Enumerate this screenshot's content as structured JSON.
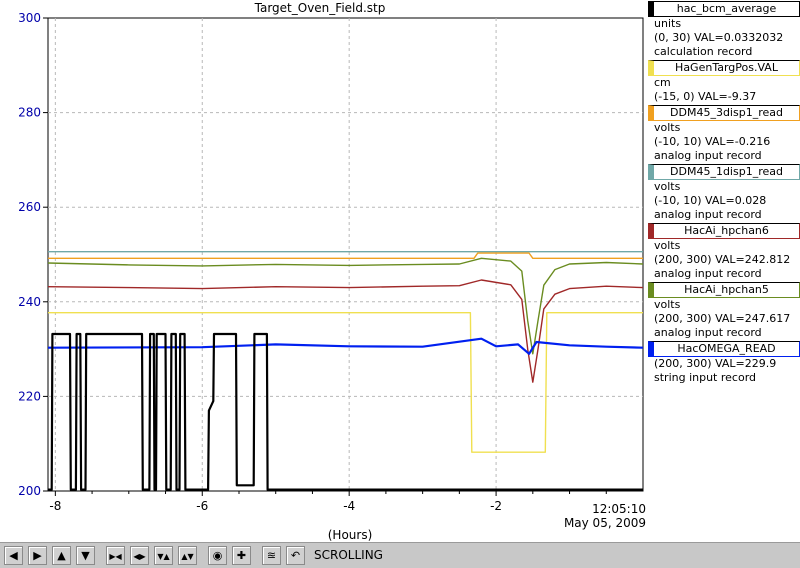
{
  "window_title": "Target_Oven_Field.stp",
  "x_axis_unit": "(Hours)",
  "timestamp": {
    "time": "12:05:10",
    "date": "May 05, 2009"
  },
  "legend": [
    {
      "name": "hac_bcm_average",
      "color": "#000000",
      "lines": [
        "units",
        "(0, 30) VAL=0.0332032",
        "calculation record"
      ]
    },
    {
      "name": "HaGenTargPos.VAL",
      "color": "#f0e050",
      "lines": [
        "cm",
        "(-15, 0) VAL=-9.37"
      ]
    },
    {
      "name": "DDM45_3disp1_read",
      "color": "#f0a020",
      "lines": [
        "volts",
        "(-10, 10) VAL=-0.216",
        "analog input record"
      ]
    },
    {
      "name": "DDM45_1disp1_read",
      "color": "#70a8a8",
      "lines": [
        "volts",
        "(-10, 10) VAL=0.028",
        "analog input record"
      ]
    },
    {
      "name": "HacAi_hpchan6",
      "color": "#a02828",
      "lines": [
        "volts",
        "(200, 300) VAL=242.812",
        "analog input record"
      ]
    },
    {
      "name": "HacAi_hpchan5",
      "color": "#6a8c20",
      "lines": [
        "volts",
        "(200, 300) VAL=247.617",
        "analog input record"
      ]
    },
    {
      "name": "HacOMEGA_READ",
      "color": "#0020f0",
      "lines": [
        "(200, 300) VAL=229.9",
        "string input record"
      ]
    }
  ],
  "toolbar": {
    "buttons": [
      {
        "name": "scroll-left-button",
        "icon": "arrow-left-icon",
        "glyph": "◀"
      },
      {
        "name": "scroll-right-button",
        "icon": "arrow-right-icon",
        "glyph": "▶"
      },
      {
        "name": "scroll-up-button",
        "icon": "arrow-up-icon",
        "glyph": "▲"
      },
      {
        "name": "scroll-down-button",
        "icon": "arrow-down-icon",
        "glyph": "▼"
      },
      {
        "name": "zoom-in-horizontal-button",
        "icon": "zoom-in-horizontal-icon",
        "glyph": "▶◀"
      },
      {
        "name": "zoom-out-horizontal-button",
        "icon": "zoom-out-horizontal-icon",
        "glyph": "◀▶"
      },
      {
        "name": "zoom-in-vertical-button",
        "icon": "zoom-in-vertical-icon",
        "glyph": "▼▲"
      },
      {
        "name": "zoom-out-vertical-button",
        "icon": "zoom-out-vertical-icon",
        "glyph": "▲▼"
      },
      {
        "name": "autozoom-button",
        "icon": "target-icon",
        "glyph": "◉"
      },
      {
        "name": "add-cursor-button",
        "icon": "plus-icon",
        "glyph": "✚"
      },
      {
        "name": "stagger-button",
        "icon": "stagger-icon",
        "glyph": "≊"
      },
      {
        "name": "undo-button",
        "icon": "undo-icon",
        "glyph": "↶"
      }
    ],
    "status": "SCROLLING"
  },
  "chart_data": {
    "type": "line",
    "title": "Target_Oven_Field.stp",
    "xlabel": "(Hours)",
    "ylabel": "",
    "xlim": [
      -8.1,
      0
    ],
    "ylim": [
      200,
      300
    ],
    "x_ticks": [
      -8,
      -6,
      -4,
      -2
    ],
    "y_ticks": [
      200,
      220,
      240,
      260,
      280,
      300
    ],
    "grid": true,
    "legend_position": "right",
    "series": [
      {
        "name": "DDM45_1disp1_read",
        "color": "#70a8a8",
        "points": [
          [
            -8.1,
            250.6
          ],
          [
            0,
            250.6
          ]
        ]
      },
      {
        "name": "DDM45_3disp1_read",
        "color": "#f0a020",
        "points": [
          [
            -8.1,
            249.2
          ],
          [
            -2.3,
            249.2
          ],
          [
            -2.25,
            250.3
          ],
          [
            -1.55,
            250.3
          ],
          [
            -1.5,
            249.2
          ],
          [
            0,
            249.2
          ]
        ]
      },
      {
        "name": "HacAi_hpchan5",
        "color": "#6a8c20",
        "points": [
          [
            -8.1,
            248.2
          ],
          [
            -7.0,
            247.8
          ],
          [
            -6.0,
            247.6
          ],
          [
            -5.0,
            247.9
          ],
          [
            -4.0,
            247.7
          ],
          [
            -3.0,
            247.9
          ],
          [
            -2.5,
            248.0
          ],
          [
            -2.2,
            249.2
          ],
          [
            -1.8,
            248.6
          ],
          [
            -1.65,
            246.5
          ],
          [
            -1.57,
            236.0
          ],
          [
            -1.5,
            229.0
          ],
          [
            -1.43,
            236.0
          ],
          [
            -1.35,
            243.5
          ],
          [
            -1.2,
            246.8
          ],
          [
            -1.0,
            248.0
          ],
          [
            -0.5,
            248.3
          ],
          [
            0,
            248.0
          ]
        ]
      },
      {
        "name": "HacAi_hpchan6",
        "color": "#a02828",
        "points": [
          [
            -8.1,
            243.2
          ],
          [
            -7.0,
            243.0
          ],
          [
            -6.0,
            242.8
          ],
          [
            -5.0,
            243.2
          ],
          [
            -4.0,
            243.0
          ],
          [
            -3.0,
            243.3
          ],
          [
            -2.5,
            243.4
          ],
          [
            -2.2,
            244.6
          ],
          [
            -1.8,
            243.6
          ],
          [
            -1.65,
            240.5
          ],
          [
            -1.57,
            230.0
          ],
          [
            -1.5,
            223.0
          ],
          [
            -1.43,
            230.0
          ],
          [
            -1.35,
            238.5
          ],
          [
            -1.2,
            241.6
          ],
          [
            -1.0,
            242.8
          ],
          [
            -0.5,
            243.3
          ],
          [
            0,
            243.0
          ]
        ]
      },
      {
        "name": "HaGenTargPos.VAL",
        "color": "#f0e050",
        "points": [
          [
            -8.1,
            237.7
          ],
          [
            -2.35,
            237.7
          ],
          [
            -2.33,
            208.2
          ],
          [
            -1.33,
            208.2
          ],
          [
            -1.31,
            237.7
          ],
          [
            0,
            237.7
          ]
        ]
      },
      {
        "name": "HacOMEGA_READ",
        "color": "#0020f0",
        "points": [
          [
            -8.1,
            230.3
          ],
          [
            -6.0,
            230.4
          ],
          [
            -5.0,
            231.0
          ],
          [
            -4.0,
            230.6
          ],
          [
            -3.0,
            230.5
          ],
          [
            -2.2,
            232.2
          ],
          [
            -2.0,
            230.6
          ],
          [
            -1.7,
            231.0
          ],
          [
            -1.55,
            229.0
          ],
          [
            -1.45,
            231.5
          ],
          [
            -1.0,
            230.8
          ],
          [
            -0.5,
            230.5
          ],
          [
            0,
            230.3
          ]
        ]
      },
      {
        "name": "hac_bcm_average",
        "color": "#000000",
        "points": [
          [
            -8.1,
            200.3
          ],
          [
            -8.05,
            200.3
          ],
          [
            -8.04,
            233.2
          ],
          [
            -7.8,
            233.2
          ],
          [
            -7.79,
            200.3
          ],
          [
            -7.72,
            200.3
          ],
          [
            -7.71,
            233.2
          ],
          [
            -7.66,
            233.2
          ],
          [
            -7.65,
            200.3
          ],
          [
            -7.59,
            200.3
          ],
          [
            -7.58,
            233.2
          ],
          [
            -6.82,
            233.2
          ],
          [
            -6.81,
            200.3
          ],
          [
            -6.72,
            200.3
          ],
          [
            -6.71,
            233.2
          ],
          [
            -6.66,
            233.2
          ],
          [
            -6.65,
            200.3
          ],
          [
            -6.63,
            200.3
          ],
          [
            -6.62,
            233.2
          ],
          [
            -6.5,
            233.2
          ],
          [
            -6.49,
            200.3
          ],
          [
            -6.43,
            200.3
          ],
          [
            -6.42,
            233.2
          ],
          [
            -6.36,
            233.2
          ],
          [
            -6.35,
            200.3
          ],
          [
            -6.31,
            200.3
          ],
          [
            -6.3,
            233.2
          ],
          [
            -6.24,
            233.2
          ],
          [
            -6.23,
            200.3
          ],
          [
            -5.92,
            200.3
          ],
          [
            -5.91,
            217.0
          ],
          [
            -5.85,
            219.0
          ],
          [
            -5.84,
            233.2
          ],
          [
            -5.54,
            233.2
          ],
          [
            -5.53,
            201.2
          ],
          [
            -5.3,
            201.2
          ],
          [
            -5.29,
            233.2
          ],
          [
            -5.12,
            233.2
          ],
          [
            -5.11,
            200.3
          ],
          [
            0,
            200.3
          ]
        ]
      }
    ]
  }
}
